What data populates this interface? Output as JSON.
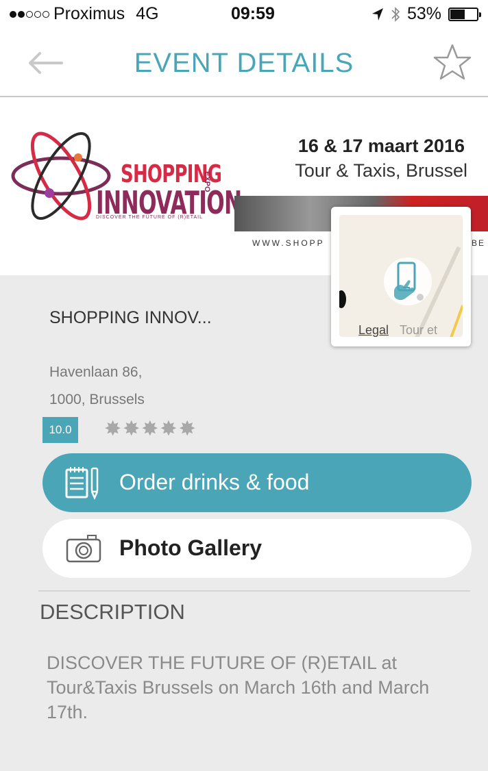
{
  "status_bar": {
    "carrier": "Proximus",
    "network": "4G",
    "time": "09:59",
    "battery": "53%",
    "battery_level": 0.53,
    "signal_bars_filled": 2,
    "signal_bars_total": 5
  },
  "nav": {
    "title": "EVENT DETAILS",
    "accent_color": "#4aa6b6"
  },
  "banner": {
    "logo_line1": "SHOPPING",
    "logo_line2": "INNOVATION",
    "logo_expo": "EXPO",
    "logo_tagline": "DISCOVER THE FUTURE OF (R)ETAIL",
    "date": "16 & 17 maart 2016",
    "venue": "Tour & Taxis, Brussel",
    "website_left": "WWW.SHOPP",
    "website_right": "BE"
  },
  "map_popup": {
    "legal": "Legal",
    "place": "Tour et Taxis"
  },
  "venue": {
    "name": "SHOPPING INNOV...",
    "address_line1": "Havenlaan 86,",
    "address_line2": "1000, Brussels",
    "rating": "10.0",
    "stars_total": 5
  },
  "actions": {
    "order_label": "Order drinks & food",
    "photo_label": "Photo Gallery"
  },
  "description": {
    "heading": "DESCRIPTION",
    "text": "DISCOVER THE FUTURE OF (R)ETAIL at Tour&Taxis Brussels on March 16th and March 17th."
  }
}
